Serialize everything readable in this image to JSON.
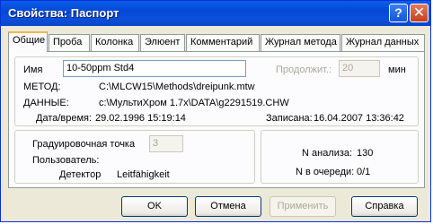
{
  "window": {
    "title": "Свойства: Паспорт",
    "help_glyph": "?",
    "close_glyph": "✕"
  },
  "tabs": [
    "Общие",
    "Проба",
    "Колонка",
    "Элюент",
    "Комментарий",
    "Журнал метода",
    "Журнал данных"
  ],
  "general": {
    "name_label": "Имя",
    "name_value": "10-50ppm Std4",
    "duration_label": "Продолжит.:",
    "duration_value": "20",
    "duration_unit": "мин",
    "method_label": "МЕТОД:",
    "method_value": "C:\\MLCW15\\Methods\\dreipunk.mtw",
    "data_label": "ДАННЫЕ:",
    "data_value": "c:\\МультиХром 1.7x\\DATA\\g2291519.CHW",
    "datetime_label": "Дата/время:",
    "datetime_value": "29.02.1996 15:19:14",
    "recorded_label": "Записана:",
    "recorded_value": "16.04.2007 13:36:42"
  },
  "calibration": {
    "point_label": "Градуировочная точка",
    "point_value": "3",
    "user_label": "Пользователь:",
    "user_value": "",
    "detector_label": "Детектор",
    "detector_value": "Leitfähigkeit"
  },
  "analysis": {
    "n_analysis_label": "N анализа:",
    "n_analysis_value": "130",
    "queue_label": "N в очереди:",
    "queue_value": "0/1"
  },
  "buttons": {
    "ok": "OK",
    "cancel": "Отмена",
    "apply": "Применить",
    "help": "Справка"
  }
}
